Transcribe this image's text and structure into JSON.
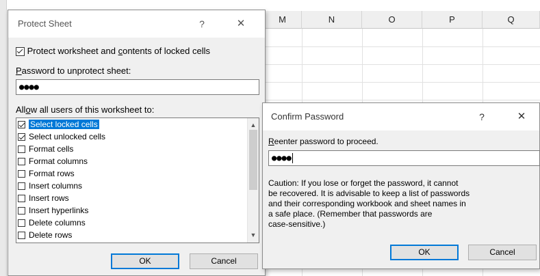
{
  "spreadsheet": {
    "columns": [
      "M",
      "N",
      "O",
      "P",
      "Q"
    ]
  },
  "protect_dialog": {
    "title": "Protect Sheet",
    "help": "?",
    "close": "✕",
    "protect_checkbox": {
      "checked": true,
      "label_pre": "Protect worksheet and ",
      "label_ul": "c",
      "label_post": "ontents of locked cells"
    },
    "password_label_ul": "P",
    "password_label_rest": "assword to unprotect sheet:",
    "password_value": "●●●●",
    "allow_label_pre": "All",
    "allow_label_ul": "o",
    "allow_label_post": "w all users of this worksheet to:",
    "items": [
      {
        "label": "Select locked cells",
        "checked": true,
        "selected": true
      },
      {
        "label": "Select unlocked cells",
        "checked": true,
        "selected": false
      },
      {
        "label": "Format cells",
        "checked": false,
        "selected": false
      },
      {
        "label": "Format columns",
        "checked": false,
        "selected": false
      },
      {
        "label": "Format rows",
        "checked": false,
        "selected": false
      },
      {
        "label": "Insert columns",
        "checked": false,
        "selected": false
      },
      {
        "label": "Insert rows",
        "checked": false,
        "selected": false
      },
      {
        "label": "Insert hyperlinks",
        "checked": false,
        "selected": false
      },
      {
        "label": "Delete columns",
        "checked": false,
        "selected": false
      },
      {
        "label": "Delete rows",
        "checked": false,
        "selected": false
      }
    ],
    "ok": "OK",
    "cancel": "Cancel"
  },
  "confirm_dialog": {
    "title": "Confirm Password",
    "help": "?",
    "close": "✕",
    "reenter_label_ul": "R",
    "reenter_label_rest": "eenter password to proceed.",
    "password_value": "●●●●",
    "caution_lines": [
      "Caution: If you lose or forget the password, it cannot",
      "be recovered. It is advisable to keep a list of passwords",
      "and their corresponding workbook and sheet names in",
      "a safe place.  (Remember that passwords are",
      "case-sensitive.)"
    ],
    "ok": "OK",
    "cancel": "Cancel"
  },
  "colors": {
    "accent": "#0078d7",
    "dialog_bg": "#f0f0f0",
    "title_bg": "#ffffff"
  }
}
